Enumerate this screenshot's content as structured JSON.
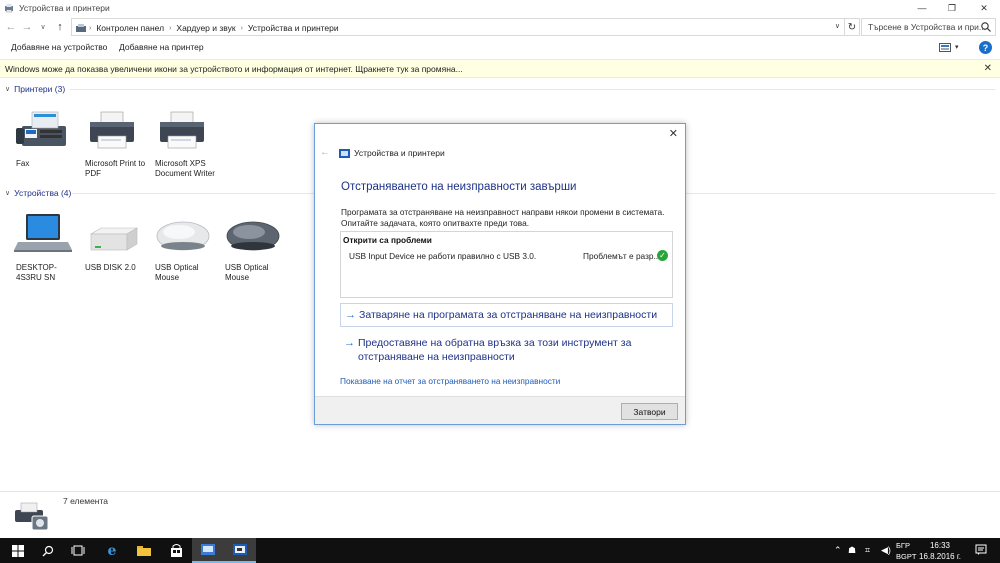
{
  "window": {
    "title": "Устройства и принтери",
    "minimize": "—",
    "maximize": "❐",
    "close": "✕"
  },
  "address": {
    "breadcrumbs": [
      "Контролен панел",
      "Хардуер и звук",
      "Устройства и принтери"
    ],
    "search_placeholder": "Търсене в Устройства и при..."
  },
  "toolbar": {
    "add_device": "Добавяне на устройство",
    "add_printer": "Добавяне на принтер",
    "help": "?"
  },
  "infobar": {
    "text": "Windows може да показва увеличени икони за устройството и информация от интернет. Щракнете тук за промяна...",
    "close": "✕"
  },
  "groups": {
    "printers": {
      "header": "Принтери (3)",
      "items": [
        {
          "label": "Fax"
        },
        {
          "label": "Microsoft Print to PDF"
        },
        {
          "label": "Microsoft XPS Document Writer"
        }
      ]
    },
    "devices": {
      "header": "Устройства (4)",
      "items": [
        {
          "label": "DESKTOP-4S3RU SN"
        },
        {
          "label": "USB DISK 2.0"
        },
        {
          "label": "USB Optical Mouse"
        },
        {
          "label": "USB Optical Mouse"
        }
      ]
    }
  },
  "statusbar": {
    "count": "7 елемента"
  },
  "dialog": {
    "title": "Устройства и принтери",
    "heading": "Отстраняването на неизправности завърши",
    "description": "Програмата за отстраняване на неизправност направи някои промени в системата. Опитайте задачата, която опитвахте преди това.",
    "problems_header": "Открити са проблеми",
    "problem_item": "USB Input Device не работи правилно с USB 3.0.",
    "problem_status": "Проблемът е разр...",
    "link_close": "Затваряне на програмата за отстраняване на неизправности",
    "link_feedback": "Предоставяне на обратна връзка за този инструмент за отстраняване на неизправности",
    "report_link": "Показване на отчет за отстраняването на неизправности",
    "close_button": "Затвори"
  },
  "taskbar": {
    "lang_top": "БГР",
    "lang_bottom": "BGPT",
    "time": "16:33",
    "date": "16.8.2016 г."
  },
  "colors": {
    "accent": "#1e3287",
    "link": "#1e5bb8",
    "infobar_bg": "#ffffe1",
    "taskbar_bg": "#101010",
    "dialog_border": "#6b9ed8",
    "ok_green": "#29a33b"
  }
}
